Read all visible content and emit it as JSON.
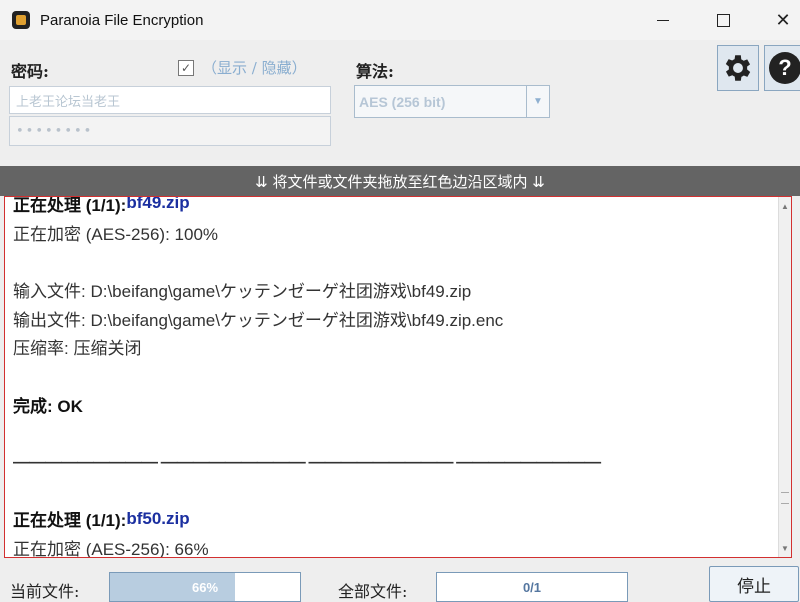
{
  "window": {
    "title": "Paranoia File Encryption",
    "minimize": "minimize",
    "maximize": "maximize",
    "close": "✕"
  },
  "password": {
    "label": "密码:",
    "show_hide_checked": true,
    "show_hide_label": "（显示 / 隐藏）",
    "field1_value": "上老王论坛当老王",
    "field2_value": "••••••••"
  },
  "algorithm": {
    "label": "算法:",
    "selected": "AES (256 bit)"
  },
  "toolbar": {
    "settings_icon": "gear-icon",
    "help_label": "?"
  },
  "drop_banner": "⇊ 将文件或文件夹拖放至红色边沿区域内 ⇊",
  "log": {
    "lines": [
      {
        "parts": [
          {
            "t": "正在处理 (1/1): ",
            "c": "b"
          },
          {
            "t": "bf49.zip",
            "c": "fn"
          }
        ]
      },
      {
        "parts": [
          {
            "t": "正在加密 (AES-256): 100%",
            "c": ""
          }
        ]
      },
      {
        "parts": [
          {
            "t": "",
            "c": ""
          }
        ]
      },
      {
        "parts": [
          {
            "t": "输入文件: D:\\beifang\\game\\ケッテンゼーゲ社团游戏\\bf49.zip",
            "c": ""
          }
        ]
      },
      {
        "parts": [
          {
            "t": "输出文件: D:\\beifang\\game\\ケッテンゼーゲ社团游戏\\bf49.zip.enc",
            "c": ""
          }
        ]
      },
      {
        "parts": [
          {
            "t": "压缩率: 压缩关闭",
            "c": ""
          }
        ]
      },
      {
        "parts": [
          {
            "t": "",
            "c": ""
          }
        ]
      },
      {
        "parts": [
          {
            "t": "完成: OK",
            "c": "b"
          }
        ]
      },
      {
        "parts": [
          {
            "t": "",
            "c": ""
          }
        ]
      },
      {
        "parts": [
          {
            "t": "————————— ————————— ————————— —————————",
            "c": "sep"
          }
        ]
      },
      {
        "parts": [
          {
            "t": "",
            "c": ""
          }
        ]
      },
      {
        "parts": [
          {
            "t": "正在处理 (1/1): ",
            "c": "b"
          },
          {
            "t": "bf50.zip",
            "c": "fn"
          }
        ]
      },
      {
        "parts": [
          {
            "t": "正在加密 (AES-256): 66%",
            "c": ""
          }
        ]
      }
    ]
  },
  "progress": {
    "current_label": "当前文件:",
    "current_percent": 66,
    "current_text": "66%",
    "total_label": "全部文件:",
    "total_fraction": 0,
    "total_text": "0/1"
  },
  "stop_label": "停止"
}
